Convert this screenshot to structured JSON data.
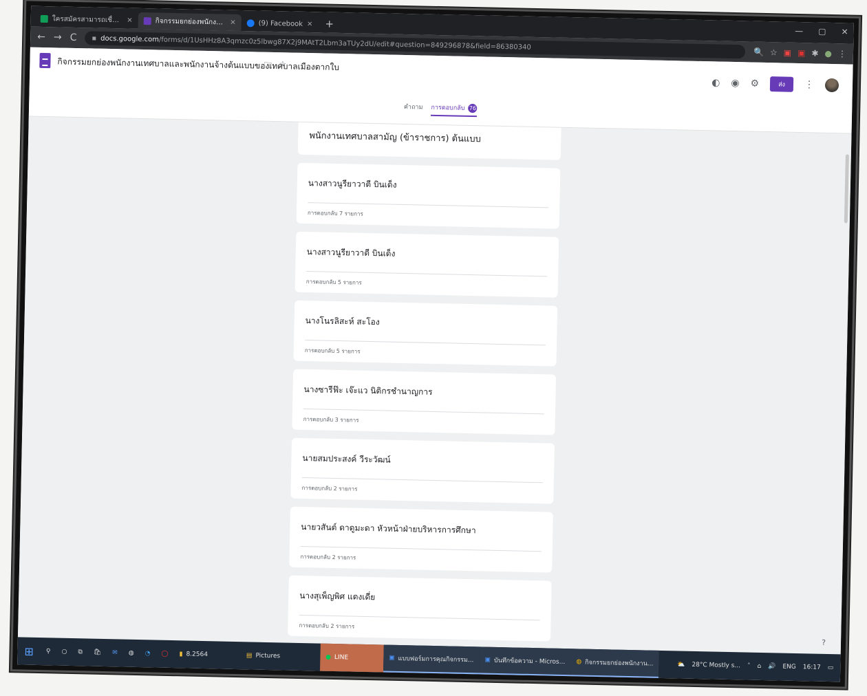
{
  "browser": {
    "tabs": [
      {
        "title": "ใครสมัครสามารถเชื่อมต่อ - Google ชีต",
        "color": "#0f9d58"
      },
      {
        "title": "กิจกรรมยกย่องพนักงานเทศบาลและพนักงานจ้าง",
        "color": "#673ab7"
      },
      {
        "title": "(9) Facebook",
        "color": "#1877f2"
      }
    ],
    "url_domain": "docs.google.com",
    "url_path": "/forms/d/1UsHHz8A3qmzc0z5lbwg87X2j9MAtT2Lbm3aTUy2dU/edit#question=849296878&field=86380340",
    "window_controls": [
      "—",
      "▢",
      "✕"
    ],
    "extensions": [
      "🔍",
      "☆",
      "▣",
      "▣",
      "✱",
      "●",
      "⋮"
    ]
  },
  "form": {
    "title": "กิจกรรมยกย่องพนักงานเทศบาลและพนักงานจ้างต้นแบบของเทศบาลเมืองตากใบ",
    "tabs": {
      "questions": "คำถาม",
      "responses": "การตอบกลับ",
      "count": "76"
    },
    "send_label": "ส่ง",
    "section_title": "พนักงานเทศบาลสามัญ (ข้าราชการ) ต้นแบบ",
    "items": [
      {
        "name": "นางสาวนูรียาวาตี บินเด็ง",
        "responses": "การตอบกลับ 7 รายการ"
      },
      {
        "name": "นางสาวนูรียาวาตี บินเด็ง",
        "responses": "การตอบกลับ 5 รายการ"
      },
      {
        "name": "นางโนรลิสะห์ สะโอง",
        "responses": "การตอบกลับ 5 รายการ"
      },
      {
        "name": "นางซารีฟ๊ะ เจ๊ะแว นิติกรชำนาญการ",
        "responses": "การตอบกลับ 3 รายการ"
      },
      {
        "name": "นายสมประสงค์ วีระวัฒน์",
        "responses": "การตอบกลับ 2 รายการ"
      },
      {
        "name": "นายวสันต์ ดาดูมะดา หัวหน้าฝ่ายบริหารการศึกษา",
        "responses": "การตอบกลับ 2 รายการ"
      },
      {
        "name": "นางสุเพ็ญพิศ แดงเดี่ย",
        "responses": "การตอบกลับ 2 รายการ"
      }
    ]
  },
  "taskbar": {
    "apps": [
      {
        "label": "8.2564",
        "style": "plain"
      },
      {
        "label": "Pictures",
        "style": "plain"
      },
      {
        "label": "LINE",
        "style": "hl"
      },
      {
        "label": "แบบฟอร์มการคุณกิจกรรม...",
        "style": "open"
      },
      {
        "label": "บันทึกข้อความ - Micros...",
        "style": "open"
      },
      {
        "label": "กิจกรรมยกย่องพนักงาน...",
        "style": "open"
      }
    ],
    "weather": "28°C Mostly s...",
    "lang": "ENG",
    "time": "16:17"
  }
}
